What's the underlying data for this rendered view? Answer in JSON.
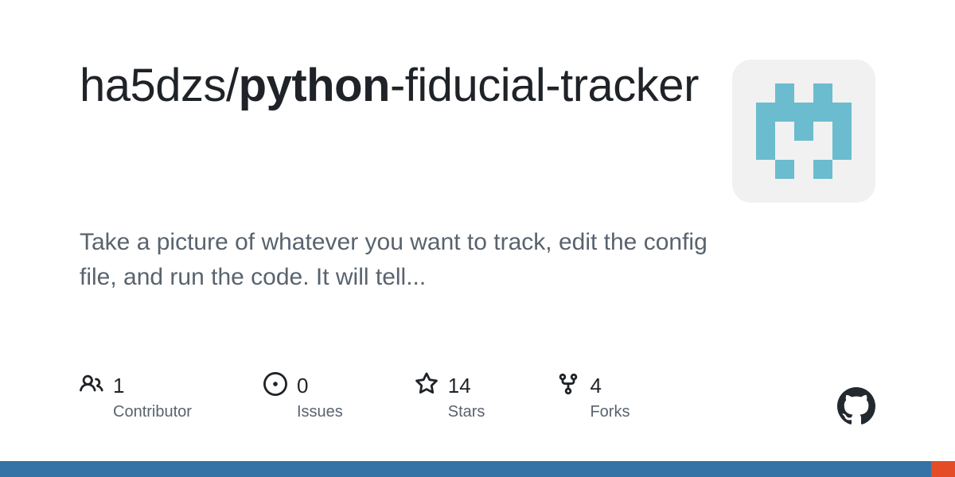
{
  "repo": {
    "owner": "ha5dzs",
    "name_bold": "python",
    "name_rest": "-fiducial-tracker",
    "description": "Take a picture of whatever you want to track, edit the config file, and run the code. It will tell..."
  },
  "stats": {
    "contributors": {
      "value": "1",
      "label": "Contributor"
    },
    "issues": {
      "value": "0",
      "label": "Issues"
    },
    "stars": {
      "value": "14",
      "label": "Stars"
    },
    "forks": {
      "value": "4",
      "label": "Forks"
    }
  },
  "languages": [
    {
      "color": "#3572A5",
      "percent": 97.5
    },
    {
      "color": "#e34c26",
      "percent": 2.5
    }
  ],
  "identicon": {
    "color": "#6bbcce",
    "grid": [
      [
        0,
        1,
        0,
        1,
        0
      ],
      [
        1,
        1,
        1,
        1,
        1
      ],
      [
        1,
        0,
        1,
        0,
        1
      ],
      [
        1,
        0,
        0,
        0,
        1
      ],
      [
        0,
        1,
        0,
        1,
        0
      ]
    ]
  }
}
